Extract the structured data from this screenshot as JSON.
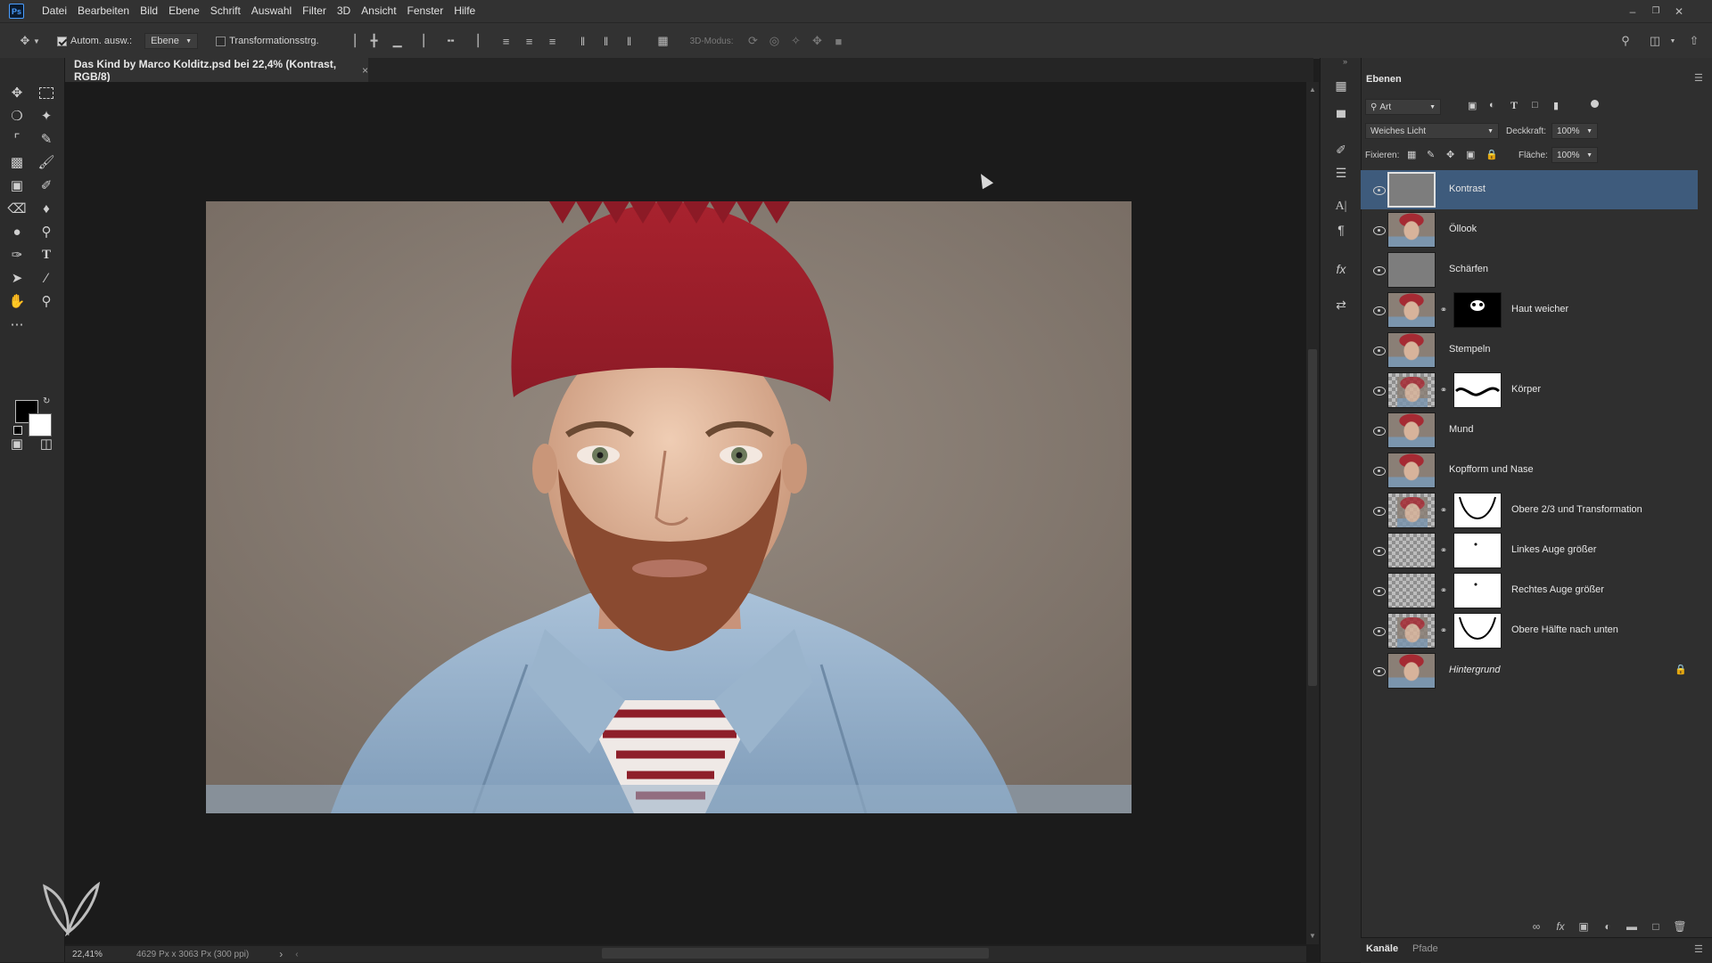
{
  "app": {
    "logo": "Ps"
  },
  "menu": [
    "Datei",
    "Bearbeiten",
    "Bild",
    "Ebene",
    "Schrift",
    "Auswahl",
    "Filter",
    "3D",
    "Ansicht",
    "Fenster",
    "Hilfe"
  ],
  "options": {
    "auto_select_label": "Autom. ausw.:",
    "auto_select_checked": true,
    "auto_select_target": "Ebene",
    "transform_controls_label": "Transformationsstrg.",
    "transform_controls_checked": false,
    "mode_3d_label": "3D-Modus:"
  },
  "document": {
    "tab_title": "Das Kind by Marco Kolditz.psd bei 22,4% (Kontrast, RGB/8)",
    "close_glyph": "×"
  },
  "status": {
    "zoom": "22,41%",
    "doc_info": "4629 Px x 3063 Px (300 ppi)",
    "arrow": "›"
  },
  "layers_panel": {
    "tab_title": "Ebenen",
    "filter_kind": "Art",
    "blend_mode": "Weiches Licht",
    "opacity_label": "Deckkraft:",
    "opacity_value": "100%",
    "lock_label": "Fixieren:",
    "fill_label": "Fläche:",
    "fill_value": "100%",
    "layers": [
      {
        "name": "Kontrast",
        "thumb": "gray",
        "mask": "",
        "selected": true,
        "italic": false,
        "locked": false
      },
      {
        "name": "Öllook",
        "thumb": "face",
        "mask": "",
        "selected": false,
        "italic": false,
        "locked": false
      },
      {
        "name": "Schärfen",
        "thumb": "gray",
        "mask": "",
        "selected": false,
        "italic": false,
        "locked": false
      },
      {
        "name": "Haut weicher",
        "thumb": "face",
        "mask": "face-blob",
        "selected": false,
        "italic": false,
        "locked": false
      },
      {
        "name": "Stempeln",
        "thumb": "face",
        "mask": "",
        "selected": false,
        "italic": false,
        "locked": false
      },
      {
        "name": "Körper",
        "thumb": "face-checker",
        "mask": "curve",
        "selected": false,
        "italic": false,
        "locked": false
      },
      {
        "name": "Mund",
        "thumb": "face",
        "mask": "",
        "selected": false,
        "italic": false,
        "locked": false
      },
      {
        "name": "Kopfform und Nase",
        "thumb": "face",
        "mask": "",
        "selected": false,
        "italic": false,
        "locked": false
      },
      {
        "name": "Obere 2/3 und Transformation",
        "thumb": "face-checker",
        "mask": "vshape",
        "selected": false,
        "italic": false,
        "locked": false
      },
      {
        "name": "Linkes Auge größer",
        "thumb": "checker",
        "mask": "dot",
        "selected": false,
        "italic": false,
        "locked": false
      },
      {
        "name": "Rechtes Auge größer",
        "thumb": "checker",
        "mask": "dot",
        "selected": false,
        "italic": false,
        "locked": false
      },
      {
        "name": "Obere Hälfte nach unten",
        "thumb": "face-checker",
        "mask": "vshape",
        "selected": false,
        "italic": false,
        "locked": false
      },
      {
        "name": "Hintergrund",
        "thumb": "face",
        "mask": "",
        "selected": false,
        "italic": true,
        "locked": true
      }
    ]
  },
  "bottom_tabs": [
    "Kanäle",
    "Pfade"
  ],
  "colors": {
    "accent_selected": "#3e5b7c",
    "foreground": "#000000",
    "background": "#ffffff"
  }
}
